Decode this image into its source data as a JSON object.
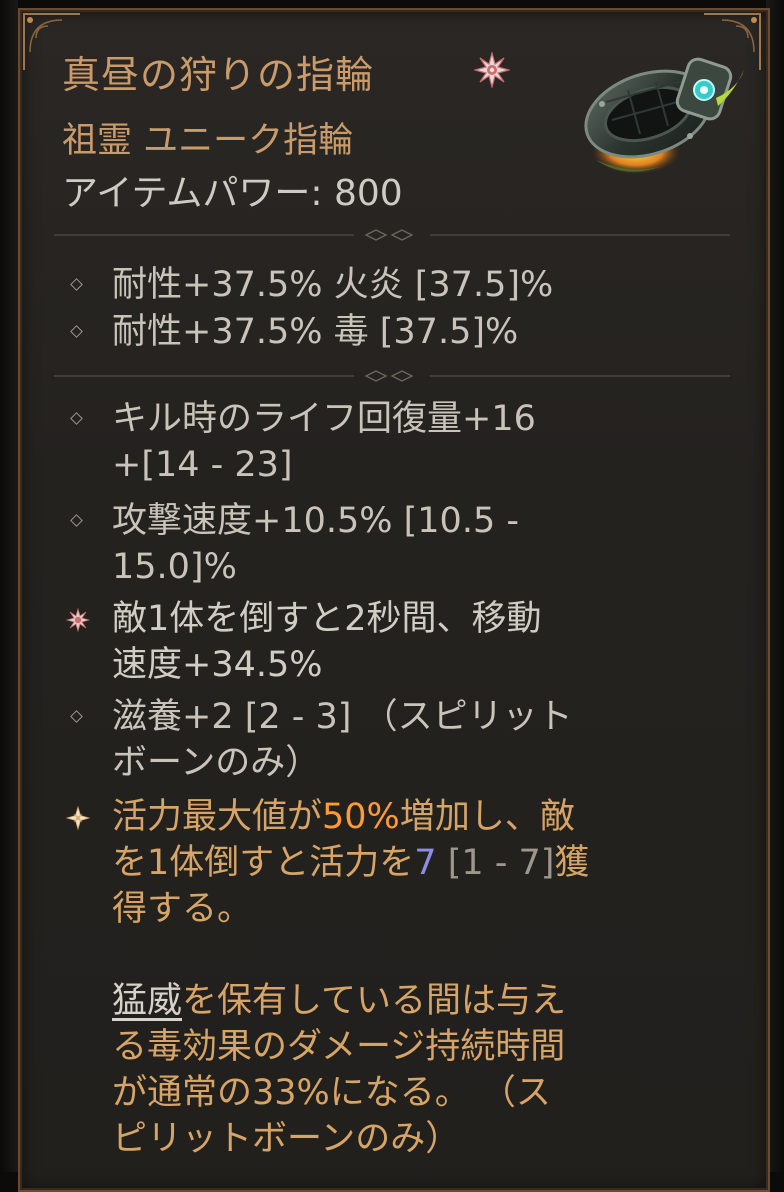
{
  "item": {
    "name": "真昼の狩りの指輪",
    "type_line": "祖霊 ユニーク指輪",
    "power_label": "アイテムパワー: 800"
  },
  "icons": {
    "title_mark": "unique-star-icon",
    "item_image": "ring-icon",
    "bullet_normal": "diamond-bullet-icon",
    "bullet_aspect": "starburst-bullet-icon",
    "bullet_unique": "sparkle-bullet-icon"
  },
  "implicits": [
    "耐性+37.5% 火炎 [37.5]%",
    "耐性+37.5% 毒 [37.5]%"
  ],
  "affixes": [
    {
      "line1": "キル時のライフ回復量+16",
      "line2": "+[14 - 23]"
    },
    {
      "line1": "攻撃速度+10.5% [10.5 -",
      "line2": "15.0]%"
    },
    {
      "line1": "敵1体を倒すと2秒間、移動",
      "line2": "速度+34.5%"
    },
    {
      "line1": "滋養+2 [2 - 3] （スピリット",
      "line2": "ボーンのみ）"
    }
  ],
  "unique_power": {
    "l1_a": "活力最大値が",
    "l1_b": "50%",
    "l1_c": "増加し、敵",
    "l2_a": "を1体倒すと活力を",
    "l2_b": "7",
    "l2_c": " [1 - 7]",
    "l2_d": "獲",
    "l3": "得する。",
    "p2_keyword": "猛威",
    "p2_l1_rest": "を保有している間は与え",
    "p2_l2": "る毒効果のダメージ持続時間",
    "p2_l3": "が通常の33%になる。 （ス",
    "p2_l4": "ピリットボーンのみ）"
  },
  "colors": {
    "title": "#c99a6a",
    "body": "#c9c3ba",
    "unique": "#d6a467",
    "highlight_orange": "#ff9a35",
    "highlight_blue": "#8d8fe6",
    "frame": "#6b4a2f"
  }
}
